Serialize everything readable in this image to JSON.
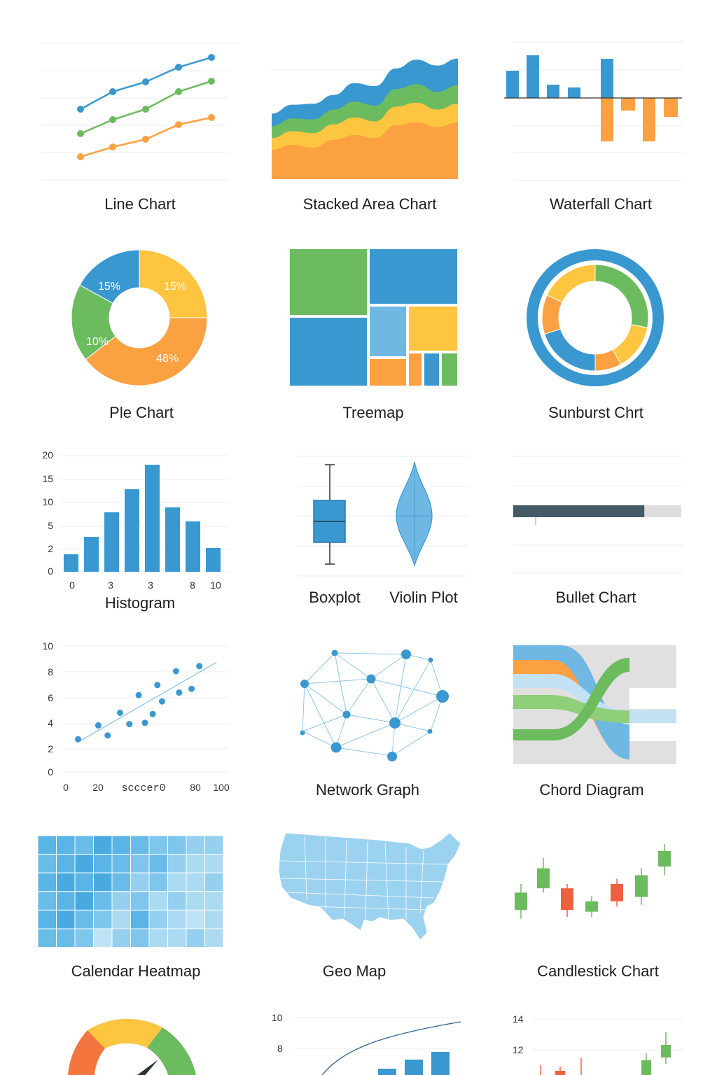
{
  "colors": {
    "blue": "#3a98d0",
    "green": "#6cbb5f",
    "yellow": "#fdc540",
    "orange": "#fca142",
    "lightblue": "#6fb8e4",
    "red": "#f06040",
    "dark": "#455a64",
    "grid": "#e6e6e6"
  },
  "labels": {
    "line": "Line Chart",
    "area": "Stacked Area Chart",
    "waterfall": "Waterfall Chart",
    "pie": "Ple Chart",
    "treemap": "Treemap",
    "sunburst": "Sunburst Chrt",
    "histogram": "Histogram",
    "boxplot": "Boxplot",
    "violin": "Violin Plot",
    "bullet": "Bullet Chart",
    "network": "Network Graph",
    "chord": "Chord Diagram",
    "calendar": "Calendar Heatmap",
    "geo": "Geo Map",
    "candlestick": "Candlestick Chart"
  },
  "chart_data": [
    {
      "id": "line",
      "type": "line",
      "series": [
        {
          "values": [
            5,
            6,
            7,
            8,
            9
          ]
        },
        {
          "values": [
            3,
            4,
            5,
            6,
            7
          ]
        },
        {
          "values": [
            1,
            2,
            3,
            4,
            5
          ]
        }
      ]
    },
    {
      "id": "area",
      "type": "area",
      "series": [
        {
          "values": [
            3,
            3.5,
            3.2,
            4,
            4.5,
            4.2,
            5.5,
            5.8,
            5.3,
            5.8
          ]
        },
        {
          "values": [
            1.2,
            1.4,
            1.5,
            1.6,
            1.8,
            1.7,
            1.9,
            2,
            1.8,
            1.9
          ]
        },
        {
          "values": [
            1.2,
            1.3,
            1.4,
            1.5,
            1.6,
            1.6,
            1.8,
            1.9,
            1.8,
            1.9
          ]
        },
        {
          "values": [
            1.3,
            1.4,
            1.6,
            1.5,
            1.9,
            2,
            2.1,
            2.5,
            2.7,
            2.7
          ]
        }
      ]
    },
    {
      "id": "waterfall",
      "type": "bar",
      "values": [
        4,
        6,
        2,
        1.5,
        0,
        6,
        -6,
        -2,
        -6,
        -3
      ]
    },
    {
      "id": "pie",
      "type": "pie",
      "slices": [
        {
          "label": "15%",
          "value": 15
        },
        {
          "label": "48%",
          "value": 48
        },
        {
          "label": "10%",
          "value": 10
        },
        {
          "label": "15%",
          "value": 15
        }
      ]
    },
    {
      "id": "histogram",
      "type": "bar",
      "yticks": [
        "20",
        "15",
        "10",
        "5",
        "2",
        "0"
      ],
      "xticks": [
        "0",
        "3",
        "3",
        "8",
        "10"
      ],
      "values": [
        2,
        4,
        9,
        14,
        19,
        12,
        7,
        3
      ],
      "ylim": [
        0,
        20
      ]
    },
    {
      "id": "bullet",
      "type": "bar",
      "value": 0.78
    },
    {
      "id": "scatter",
      "type": "scatter",
      "yticks": [
        "10",
        "8",
        "6",
        "4",
        "2",
        "0"
      ],
      "xticks": [
        "0",
        "20",
        "scccer0",
        "80",
        "100"
      ],
      "x": [
        7,
        20,
        26,
        34,
        40,
        46,
        50,
        55,
        58,
        61,
        70,
        72,
        80,
        85
      ],
      "y": [
        2.6,
        3.7,
        2.9,
        4.7,
        3.8,
        6.1,
        3.9,
        4.6,
        6.9,
        5.6,
        8,
        6.3,
        6.6,
        8.4
      ],
      "xlim": [
        0,
        100
      ],
      "ylim": [
        0,
        10
      ]
    },
    {
      "id": "candlestick",
      "type": "bar",
      "candles": [
        {
          "open": 4,
          "close": 2,
          "high": 5,
          "low": 1
        },
        {
          "open": 6.8,
          "close": 4.5,
          "high": 8,
          "low": 4
        },
        {
          "open": 4.5,
          "close": 2,
          "high": 5,
          "low": 1.2
        },
        {
          "open": 3,
          "close": 1.8,
          "high": 3.6,
          "low": 1.2
        },
        {
          "open": 3,
          "close": 5,
          "high": 5.6,
          "low": 2.4
        },
        {
          "open": 3.5,
          "close": 6,
          "high": 6.8,
          "low": 2.6
        },
        {
          "open": 7,
          "close": 8.8,
          "high": 9.6,
          "low": 6
        }
      ]
    },
    {
      "id": "bottom-middle",
      "type": "bar",
      "yticks": [
        "10",
        "8"
      ]
    },
    {
      "id": "bottom-right",
      "type": "bar",
      "yticks": [
        "14",
        "12"
      ]
    }
  ]
}
